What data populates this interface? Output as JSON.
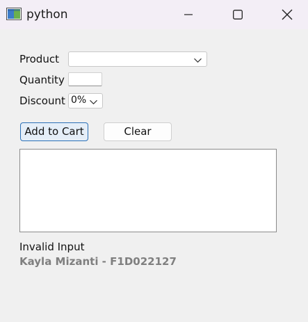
{
  "window": {
    "title": "python",
    "icon": "python-window-icon"
  },
  "form": {
    "product_label": "Product",
    "product_value": "",
    "quantity_label": "Quantity",
    "quantity_value": "",
    "discount_label": "Discount",
    "discount_value": "0%"
  },
  "buttons": {
    "add_to_cart": "Add to Cart",
    "clear": "Clear"
  },
  "cart": {
    "items": []
  },
  "status": {
    "message": "Invalid Input",
    "credit": "Kayla Mizanti - F1D022127"
  },
  "colors": {
    "accent": "#2b6fb6",
    "credit_text": "#7f7f7f",
    "background": "#f0f0f0"
  }
}
